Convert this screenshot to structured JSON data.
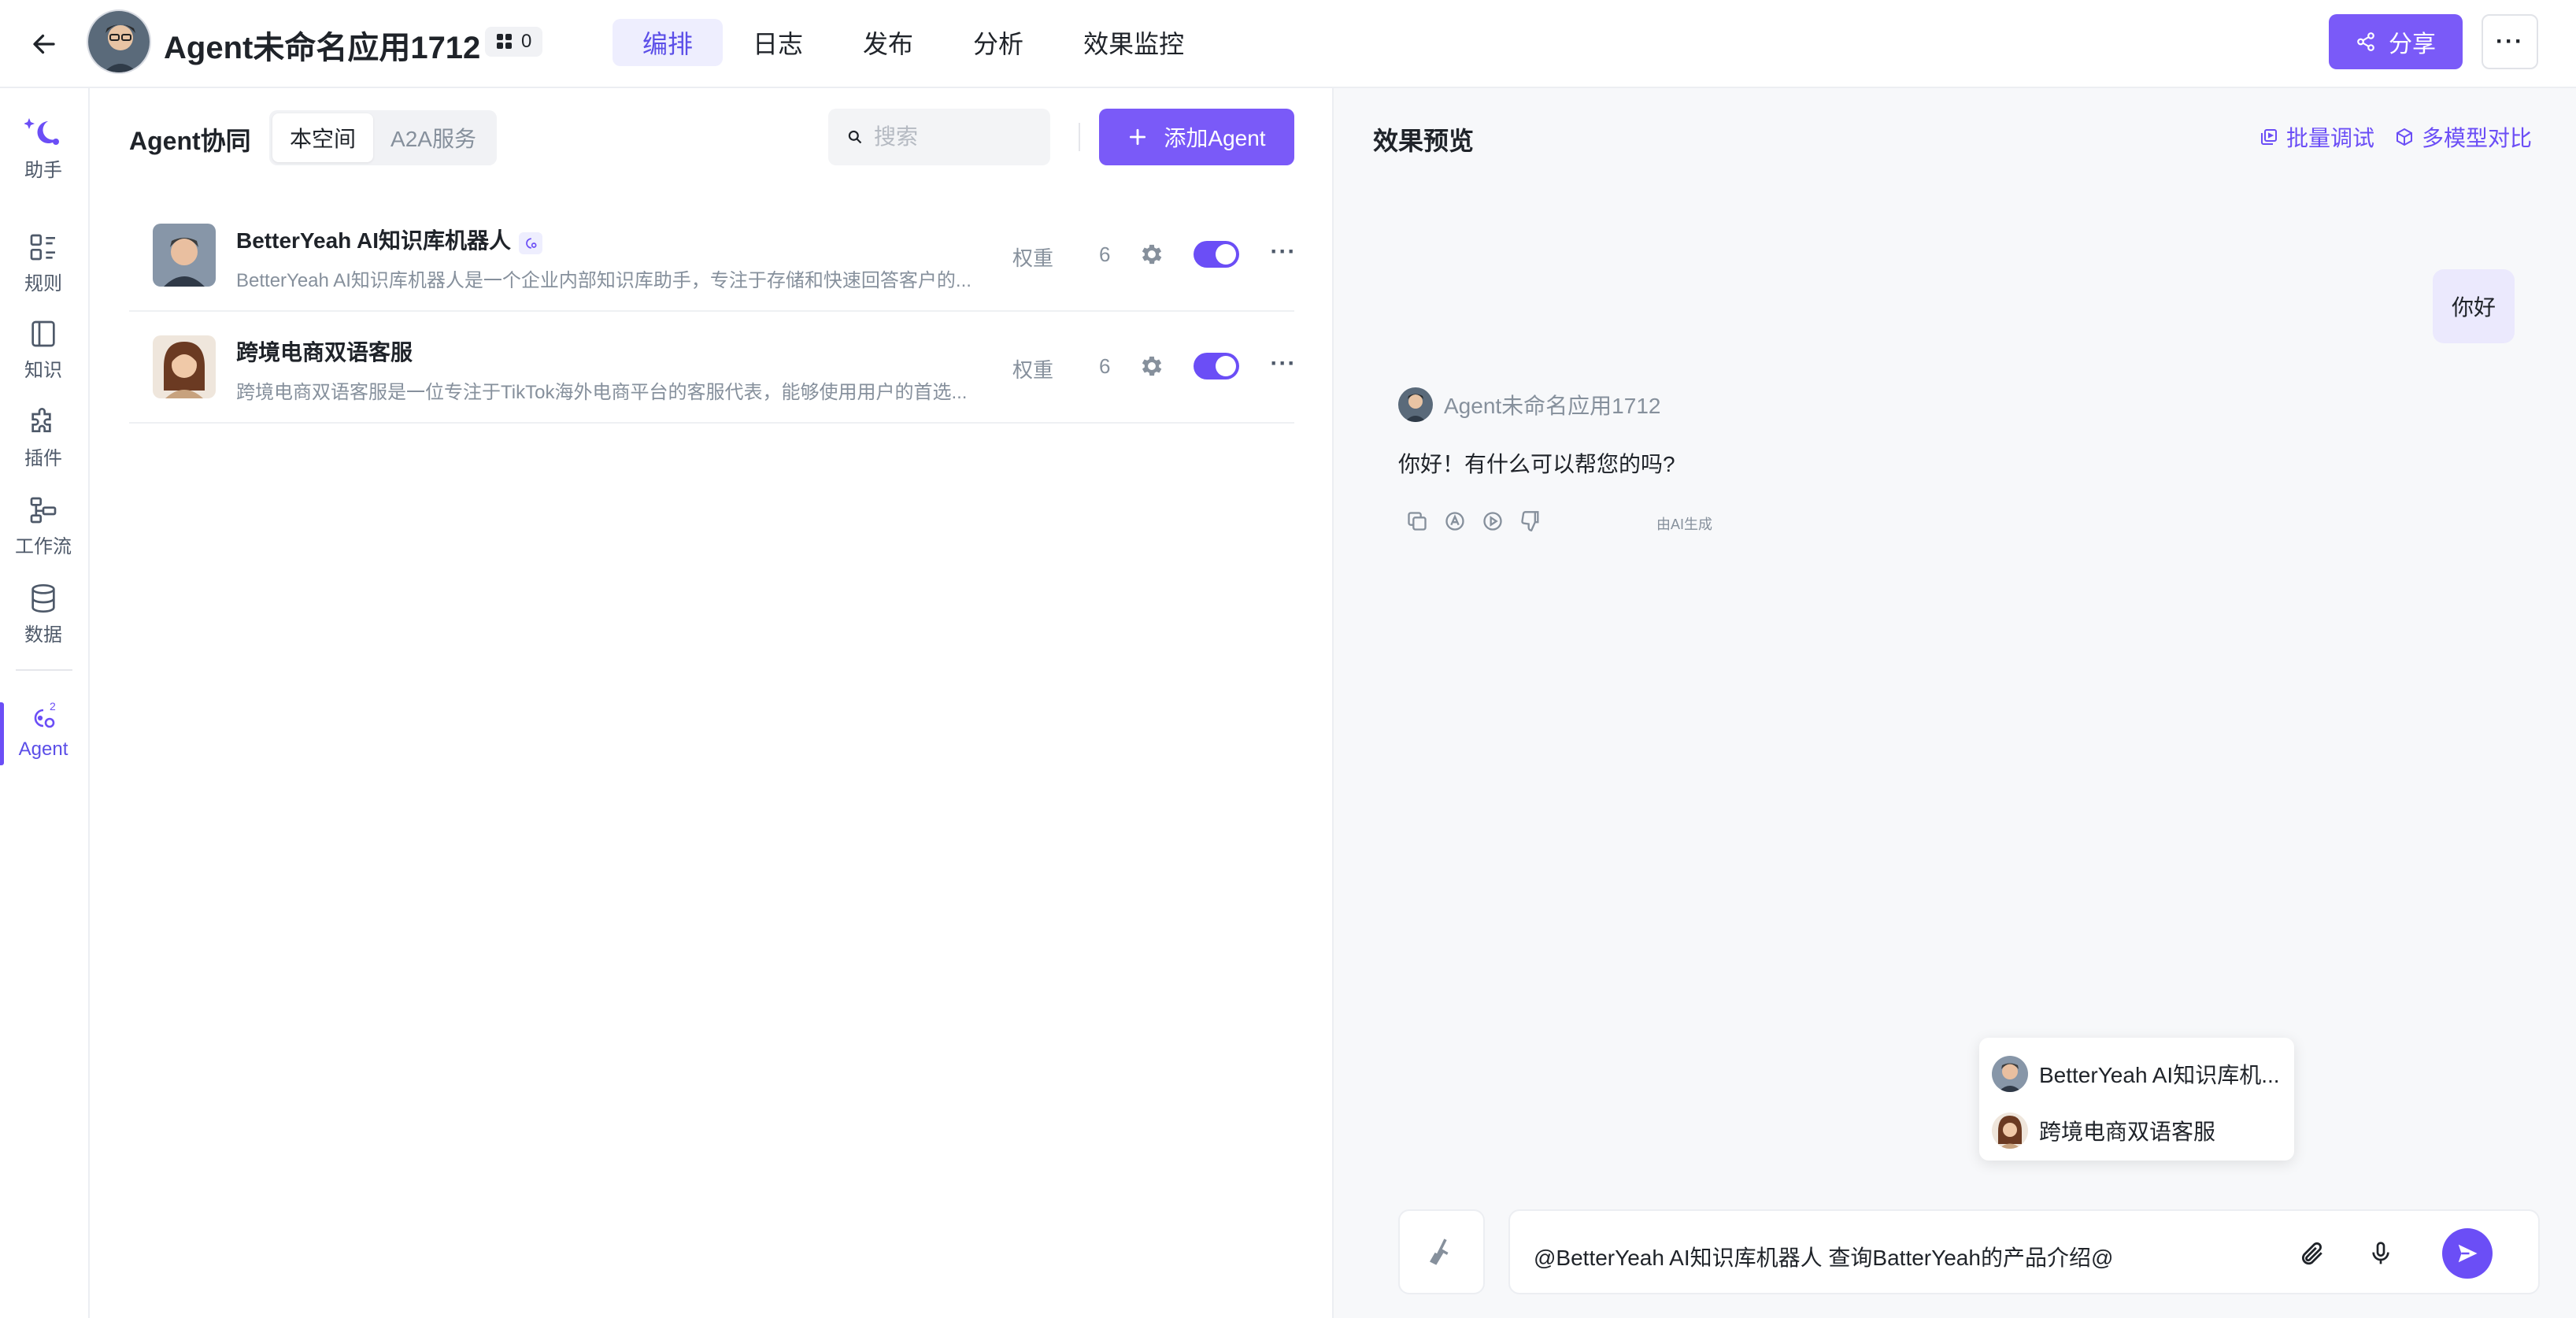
{
  "header": {
    "app_title": "Agent未命名应用1712",
    "count": "0",
    "tabs": [
      {
        "label": "编排",
        "active": true
      },
      {
        "label": "日志",
        "active": false
      },
      {
        "label": "发布",
        "active": false
      },
      {
        "label": "分析",
        "active": false
      },
      {
        "label": "效果监控",
        "active": false
      }
    ],
    "share_label": "分享",
    "more_label": "···"
  },
  "rail": {
    "items": [
      {
        "label": "助手",
        "icon": "assistant-icon"
      },
      {
        "label": "规则",
        "icon": "rules-icon"
      },
      {
        "label": "知识",
        "icon": "knowledge-icon"
      },
      {
        "label": "插件",
        "icon": "plugin-icon"
      },
      {
        "label": "工作流",
        "icon": "workflow-icon"
      },
      {
        "label": "数据",
        "icon": "database-icon"
      },
      {
        "label": "Agent",
        "icon": "agent-icon",
        "active": true
      }
    ]
  },
  "middle": {
    "title": "Agent协同",
    "segments": [
      "本空间",
      "A2A服务"
    ],
    "search_placeholder": "搜索",
    "add_label": "添加Agent",
    "weight_label": "权重",
    "agents": [
      {
        "name": "BetterYeah AI知识库机器人",
        "desc": "BetterYeah AI知识库机器人是一个企业内部知识库助手，专注于存储和快速回答客户的...",
        "weight": "6",
        "enabled": true
      },
      {
        "name": "跨境电商双语客服",
        "desc": "跨境电商双语客服是一位专注于TikTok海外电商平台的客服代表，能够使用用户的首选...",
        "weight": "6",
        "enabled": true
      }
    ]
  },
  "preview": {
    "title": "效果预览",
    "batch_label": "批量调试",
    "multi_label": "多模型对比",
    "user_msg": "你好",
    "bot_name": "Agent未命名应用1712",
    "bot_msg": "你好！有什么可以帮您的吗?",
    "ai_note": "由AI生成",
    "mentions": [
      "BetterYeah AI知识库机...",
      "跨境电商双语客服"
    ],
    "input_value": "@BetterYeah AI知识库机器人 查询BatterYeah的产品介绍@"
  },
  "colors": {
    "accent": "#7a5af8",
    "accent_dark": "#6b4ef6",
    "user_bubble": "#ebe9fd"
  }
}
